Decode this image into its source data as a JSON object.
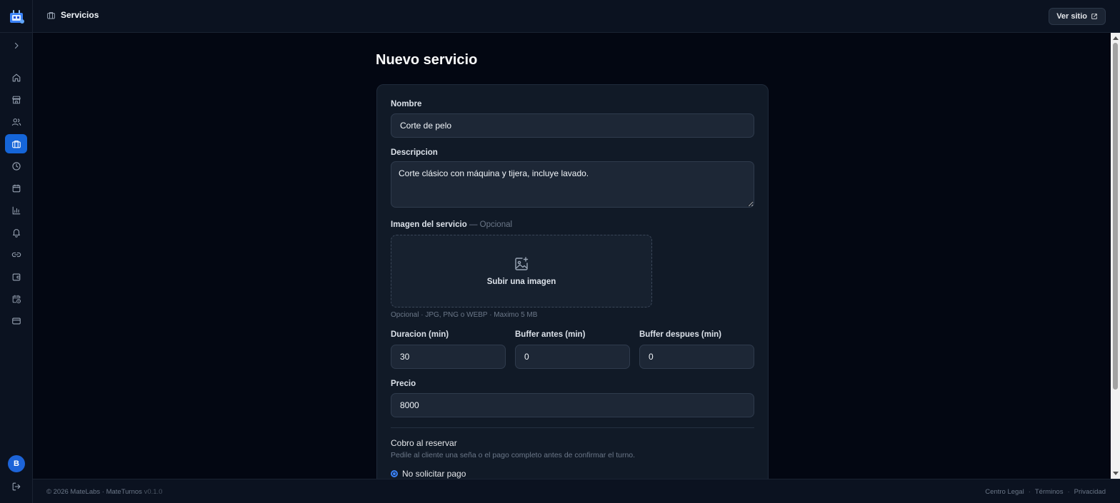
{
  "header": {
    "breadcrumb": "Servicios",
    "view_site": "Ver sitio"
  },
  "sidebar": {
    "items": [
      {
        "name": "home-icon",
        "active": false
      },
      {
        "name": "store-icon",
        "active": false
      },
      {
        "name": "users-icon",
        "active": false
      },
      {
        "name": "briefcase-icon",
        "active": true
      },
      {
        "name": "clock-icon",
        "active": false
      },
      {
        "name": "calendar-icon",
        "active": false
      },
      {
        "name": "bar-chart-icon",
        "active": false
      },
      {
        "name": "bell-icon",
        "active": false
      },
      {
        "name": "link-icon",
        "active": false
      },
      {
        "name": "wallet-icon",
        "active": false
      },
      {
        "name": "calendar-clock-icon",
        "active": false
      },
      {
        "name": "credit-card-icon",
        "active": false
      }
    ],
    "avatar_initial": "B"
  },
  "page": {
    "title": "Nuevo servicio"
  },
  "form": {
    "name_label": "Nombre",
    "name_value": "Corte de pelo",
    "description_label": "Descripcion",
    "description_value": "Corte clásico con máquina y tijera, incluye lavado.",
    "image_label": "Imagen del servicio",
    "image_optional": "— Opcional",
    "upload_text": "Subir una imagen",
    "upload_hint": "Opcional · JPG, PNG o WEBP · Maximo 5 MB",
    "duration_label": "Duracion (min)",
    "duration_value": "30",
    "buffer_before_label": "Buffer antes (min)",
    "buffer_before_value": "0",
    "buffer_after_label": "Buffer despues (min)",
    "buffer_after_value": "0",
    "price_label": "Precio",
    "price_value": "8000",
    "payment_title": "Cobro al reservar",
    "payment_desc": "Pedile al cliente una seña o el pago completo antes de confirmar el turno.",
    "payment_option": "No solicitar pago"
  },
  "footer": {
    "copyright": "© 2026 MateLabs · MateTurnos",
    "version": "v0.1.0",
    "links": [
      "Centro Legal",
      "Términos",
      "Privacidad"
    ]
  },
  "colors": {
    "accent": "#1565d8",
    "background": "#030712",
    "card": "#111a27"
  }
}
